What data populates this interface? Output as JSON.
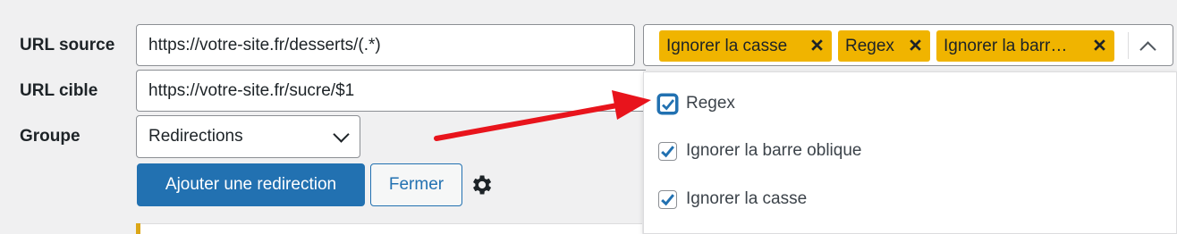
{
  "form": {
    "source_label": "URL source",
    "source_value": "https://votre-site.fr/desserts/(.*)",
    "target_label": "URL cible",
    "target_value": "https://votre-site.fr/sucre/$1",
    "group_label": "Groupe",
    "group_value": "Redirections",
    "add_button": "Ajouter une redirection",
    "close_button": "Fermer"
  },
  "flags": {
    "tags": [
      "Ignorer la casse",
      "Regex",
      "Ignorer la barr…"
    ],
    "options": [
      {
        "label": "Regex",
        "checked": true
      },
      {
        "label": "Ignorer la barre oblique",
        "checked": true
      },
      {
        "label": "Ignorer la casse",
        "checked": true
      }
    ]
  },
  "colors": {
    "accent": "#2271b1",
    "tag": "#f0b400",
    "annotation_arrow": "#e8141c"
  },
  "icons": [
    "gear-icon",
    "chevron-down-icon",
    "chevron-up-icon",
    "close-icon",
    "checkmark-icon"
  ]
}
